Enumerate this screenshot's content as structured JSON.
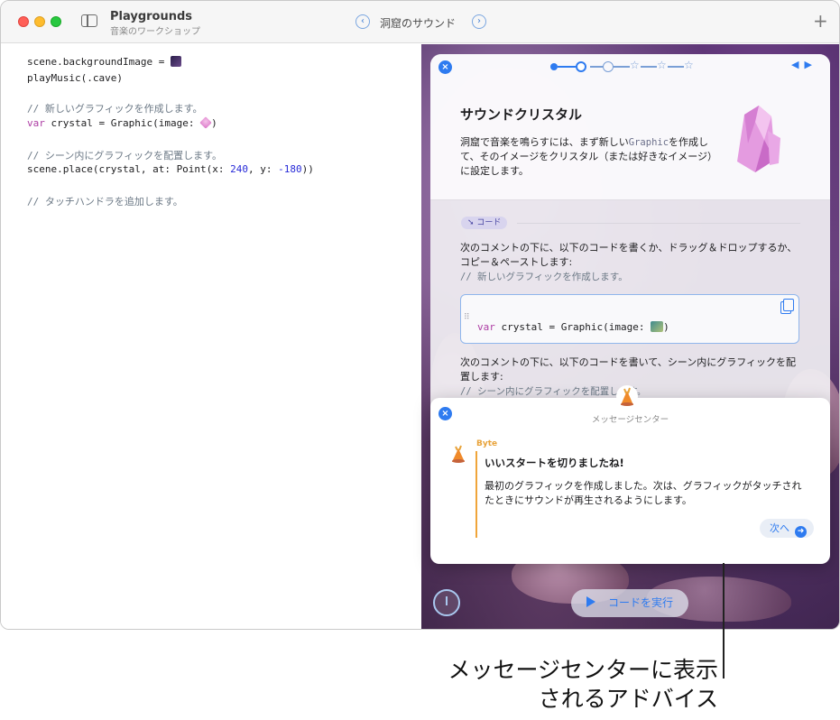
{
  "window": {
    "app_title": "Playgrounds",
    "app_subtitle": "音楽のワークショップ",
    "page_title": "洞窟のサウンド",
    "back_icon": "chevron-left-icon",
    "forward_icon": "chevron-right-icon",
    "add_label": "+"
  },
  "editor": {
    "line1_a": "scene.backgroundImage = ",
    "line2": "playMusic(.cave)",
    "line3": "// 新しいグラフィックを作成します。",
    "line4_kw": "var",
    "line4_a": " crystal = Graphic(image: ",
    "line4_b": ")",
    "line5": "// シーン内にグラフィックを配置します。",
    "line6_a": "scene.place(crystal, at: Point(x: ",
    "line6_x": "240",
    "line6_b": ", y: ",
    "line6_y": "-180",
    "line6_c": "))",
    "line7": "// タッチハンドラを追加します。"
  },
  "tutorial": {
    "title": "サウンドクリスタル",
    "intro_a": "洞窟で音楽を鳴らすには、まず新しい",
    "intro_code": "Graphic",
    "intro_b": "を作成して、そのイメージをクリスタル（または好きなイメージ）に設定します。",
    "code_tag": "コード",
    "para1": "次のコメントの下に、以下のコードを書くか、ドラッグ＆ドロップするか、コピー＆ペーストします:",
    "para1_comment": "// 新しいグラフィックを作成します。",
    "snippet_kw": "var",
    "snippet_a": " crystal = Graphic(image: ",
    "snippet_b": ")",
    "para2": "次のコメントの下に、以下のコードを書いて、シーン内にグラフィックを配置します:",
    "para2_comment": "// シーン内にグラフィックを配置します。",
    "progress_steps": 6,
    "progress_current": 2
  },
  "message_center": {
    "title": "メッセージセンター",
    "sender": "Byte",
    "heading": "いいスタートを切りましたね!",
    "body": "最初のグラフィックを作成しました。次は、グラフィックがタッチされたときにサウンドが再生されるようにします。",
    "next_label": "次へ"
  },
  "controls": {
    "run_label": "コードを実行"
  },
  "callout": {
    "line1": "メッセージセンターに表示",
    "line2": "されるアドバイス"
  },
  "colors": {
    "accent": "#2e7bf0",
    "keyword": "#ad3da4",
    "number": "#272ad8",
    "comment": "#6c7986",
    "byte_orange": "#f0a53a"
  }
}
